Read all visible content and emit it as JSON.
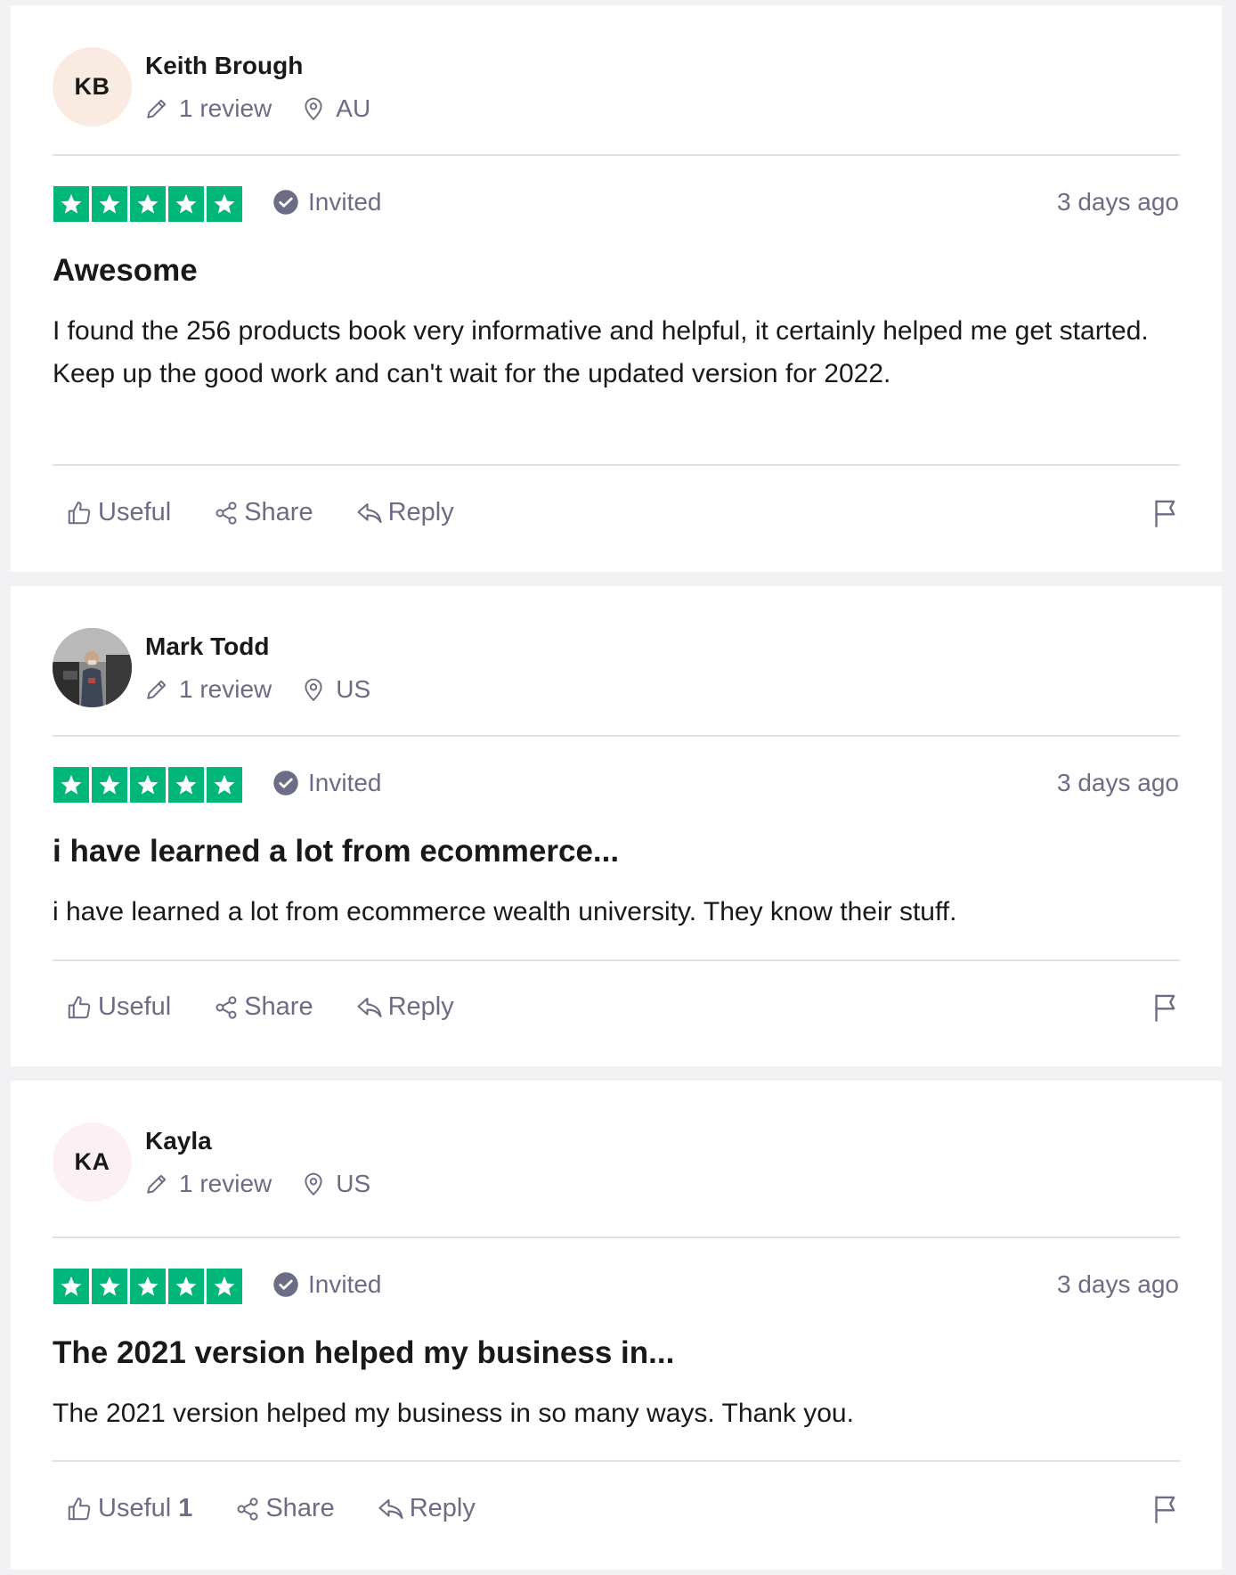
{
  "reviews": [
    {
      "reviewer": {
        "initials": "KB",
        "name": "Keith Brough",
        "review_count": "1 review",
        "country": "AU",
        "avatar_color": "#f9ebe2"
      },
      "rating": 5,
      "verification": "Invited",
      "date": "3 days ago",
      "title": "Awesome",
      "body": "I found the 256 products book very informative and helpful, it certainly helped me get started. Keep up the good work and can't wait for the updated version for 2022.",
      "actions": {
        "useful": "Useful",
        "useful_count": "",
        "share": "Share",
        "reply": "Reply"
      }
    },
    {
      "reviewer": {
        "initials": "",
        "name": "Mark Todd",
        "review_count": "1 review",
        "country": "US",
        "avatar_color": ""
      },
      "rating": 5,
      "verification": "Invited",
      "date": "3 days ago",
      "title": "i have learned a lot from ecommerce...",
      "body": "i have learned a lot from ecommerce wealth university. They know their stuff.",
      "actions": {
        "useful": "Useful",
        "useful_count": "",
        "share": "Share",
        "reply": "Reply"
      }
    },
    {
      "reviewer": {
        "initials": "KA",
        "name": "Kayla",
        "review_count": "1 review",
        "country": "US",
        "avatar_color": "#fcf0f4"
      },
      "rating": 5,
      "verification": "Invited",
      "date": "3 days ago",
      "title": "The 2021 version helped my business in...",
      "body": "The 2021 version helped my business in so many ways. Thank you.",
      "actions": {
        "useful": "Useful",
        "useful_count": "1",
        "share": "Share",
        "reply": "Reply"
      }
    }
  ],
  "colors": {
    "star_green": "#00b67a",
    "muted_text": "#6c6c85",
    "page_bg": "#f1f1f3"
  },
  "icons": [
    "pencil-icon",
    "location-pin-icon",
    "star-icon",
    "check-circle-icon",
    "thumbs-up-icon",
    "share-icon",
    "reply-icon",
    "flag-icon"
  ]
}
